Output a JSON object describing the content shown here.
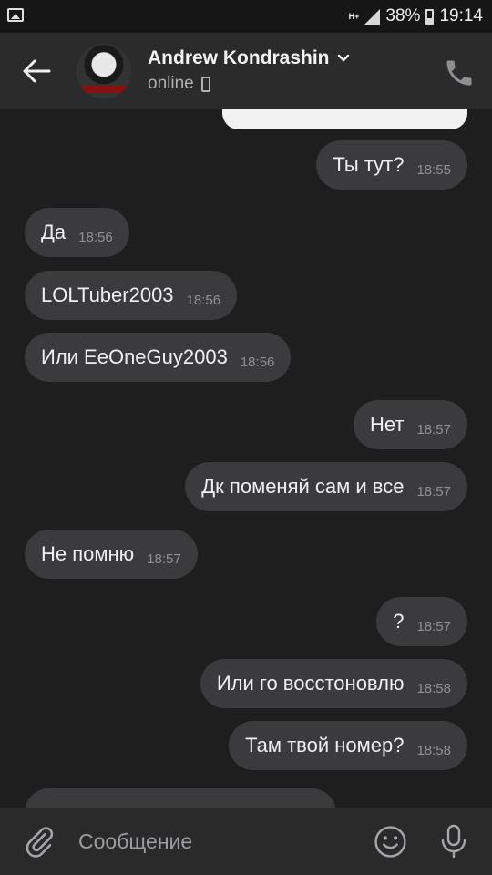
{
  "status_bar": {
    "network": "H+",
    "battery": "38%",
    "time": "19:14"
  },
  "header": {
    "contact_name": "Andrew Kondrashin",
    "status": "online"
  },
  "messages": [
    {
      "dir": "out",
      "text": "Ты тут?",
      "time": "18:55"
    },
    {
      "dir": "in",
      "text": "Да",
      "time": "18:56"
    },
    {
      "dir": "in",
      "text": "LOLTuber2003",
      "time": "18:56"
    },
    {
      "dir": "in",
      "text": "Или EeOneGuy2003",
      "time": "18:56"
    },
    {
      "dir": "out",
      "text": "Нет",
      "time": "18:57"
    },
    {
      "dir": "out",
      "text": "Дк поменяй сам и все",
      "time": "18:57"
    },
    {
      "dir": "in",
      "text": "Не помню",
      "time": "18:57"
    },
    {
      "dir": "out",
      "text": "?",
      "time": "18:57"
    },
    {
      "dir": "out",
      "text": "Или го восстоновлю",
      "time": "18:58"
    },
    {
      "dir": "out",
      "text": "Там твой номер?",
      "time": "18:58"
    }
  ],
  "input": {
    "placeholder": "Сообщение"
  },
  "icons": {
    "back": "back-arrow-icon",
    "dropdown": "chevron-down-icon",
    "device": "phone-device-icon",
    "call": "phone-call-icon",
    "attach": "paperclip-icon",
    "emoji": "smiley-icon",
    "voice": "microphone-icon"
  },
  "colors": {
    "background": "#1e1e1e",
    "header": "#2b2b2b",
    "bubble": "#3b3b3d"
  }
}
